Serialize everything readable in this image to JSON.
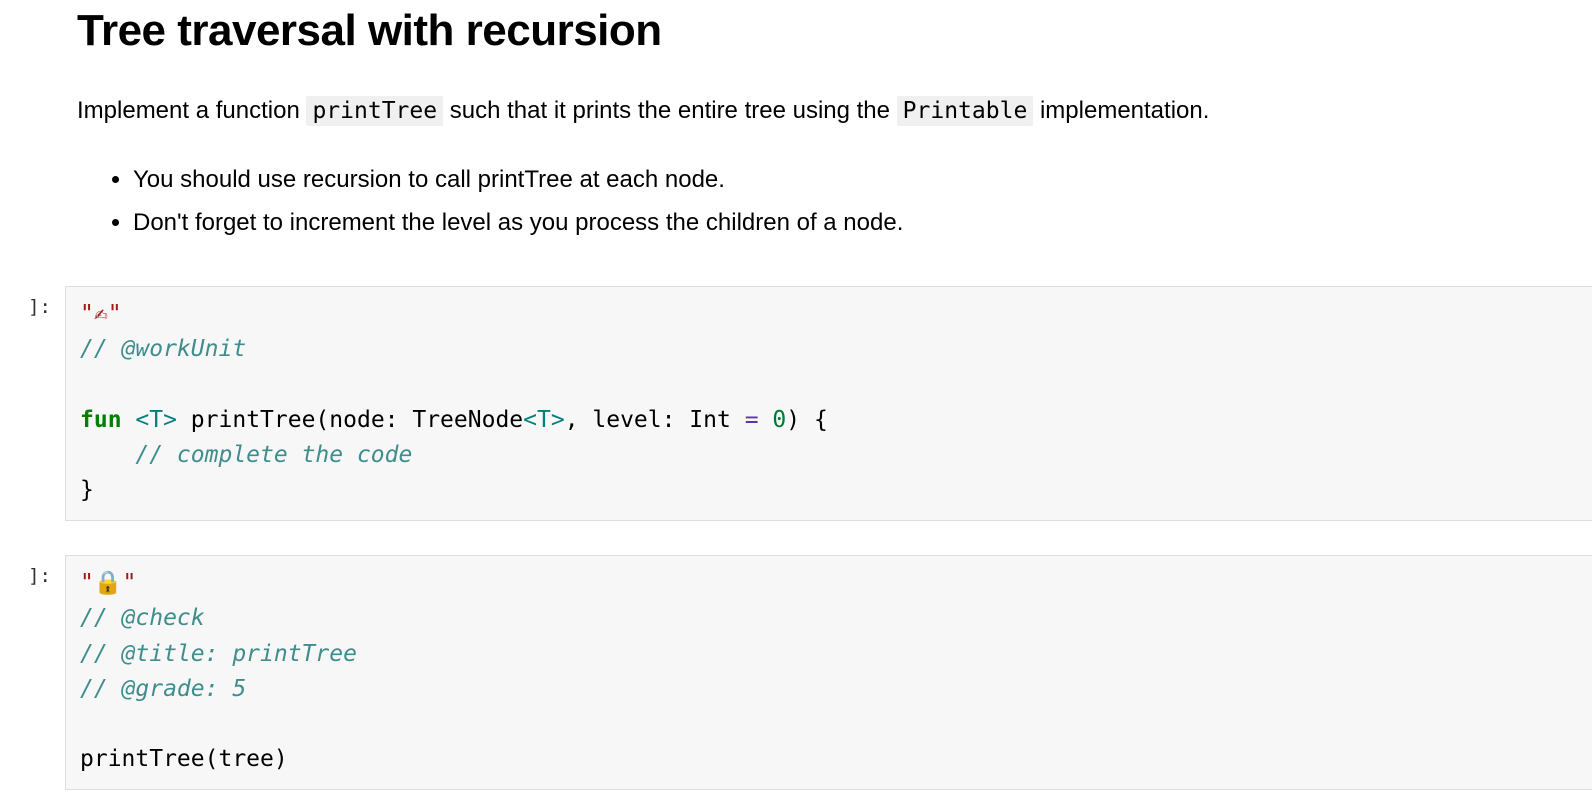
{
  "heading": "Tree traversal with recursion",
  "intro": {
    "pre": "Implement a function ",
    "code1": "printTree",
    "mid": " such that it prints the entire tree using the ",
    "code2": "Printable",
    "post": " implementation."
  },
  "hints": [
    "You should use recursion to call printTree at each node.",
    "Don't forget to increment the level as you process the children of a node."
  ],
  "cells": [
    {
      "prompt": "]:",
      "string_marker_open": "\"",
      "string_emoji": "✍",
      "string_marker_close": "\"",
      "lines": {
        "comment_workunit": "// @workUnit",
        "blank1": "",
        "fun_kw": "fun",
        "generic1": "<T>",
        "fn_name_open": " printTree(node: TreeNode",
        "generic2": "<T>",
        "after_gen": ", level: Int ",
        "eq": "= ",
        "zero": "0",
        "close_sig": ") {",
        "comment_complete": "    // complete the code",
        "close_brace": "}"
      }
    },
    {
      "prompt": "]:",
      "string_marker_open": "\"",
      "string_emoji": "🔒",
      "string_marker_close": "\"",
      "lines": {
        "c_check": "// @check",
        "c_title": "// @title: printTree",
        "c_grade": "// @grade: 5",
        "blank": "",
        "call": "printTree(tree)"
      }
    }
  ]
}
